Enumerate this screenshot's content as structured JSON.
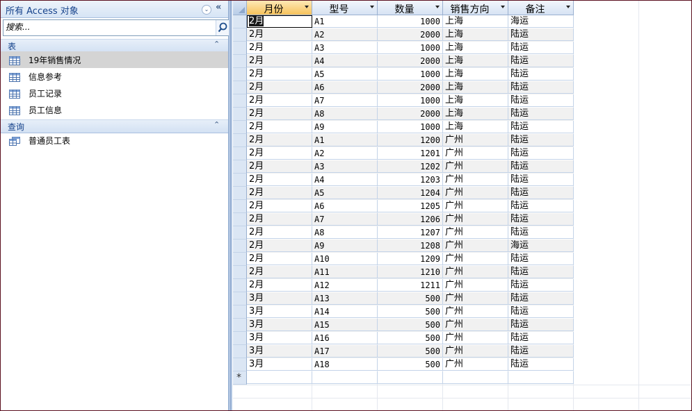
{
  "nav": {
    "title": "所有 Access 对象",
    "drop_glyph": "⌄",
    "collapse_glyph": "«",
    "search_placeholder": "搜索...",
    "groups": [
      {
        "label": "表",
        "toggle": "⌃",
        "items": [
          "19年销售情况",
          "信息参考",
          "员工记录",
          "员工信息"
        ]
      },
      {
        "label": "查询",
        "toggle": "⌃",
        "items": [
          "普通员工表"
        ]
      }
    ]
  },
  "datasheet": {
    "columns": [
      "月份",
      "型号",
      "数量",
      "销售方向",
      "备注"
    ],
    "rows": [
      [
        "2月",
        "A1",
        "1000",
        "上海",
        "海运"
      ],
      [
        "2月",
        "A2",
        "2000",
        "上海",
        "陆运"
      ],
      [
        "2月",
        "A3",
        "1000",
        "上海",
        "陆运"
      ],
      [
        "2月",
        "A4",
        "2000",
        "上海",
        "陆运"
      ],
      [
        "2月",
        "A5",
        "1000",
        "上海",
        "陆运"
      ],
      [
        "2月",
        "A6",
        "2000",
        "上海",
        "陆运"
      ],
      [
        "2月",
        "A7",
        "1000",
        "上海",
        "陆运"
      ],
      [
        "2月",
        "A8",
        "2000",
        "上海",
        "陆运"
      ],
      [
        "2月",
        "A9",
        "1000",
        "上海",
        "陆运"
      ],
      [
        "2月",
        "A1",
        "1200",
        "广州",
        "陆运"
      ],
      [
        "2月",
        "A2",
        "1201",
        "广州",
        "陆运"
      ],
      [
        "2月",
        "A3",
        "1202",
        "广州",
        "陆运"
      ],
      [
        "2月",
        "A4",
        "1203",
        "广州",
        "陆运"
      ],
      [
        "2月",
        "A5",
        "1204",
        "广州",
        "陆运"
      ],
      [
        "2月",
        "A6",
        "1205",
        "广州",
        "陆运"
      ],
      [
        "2月",
        "A7",
        "1206",
        "广州",
        "陆运"
      ],
      [
        "2月",
        "A8",
        "1207",
        "广州",
        "陆运"
      ],
      [
        "2月",
        "A9",
        "1208",
        "广州",
        "海运"
      ],
      [
        "2月",
        "A10",
        "1209",
        "广州",
        "陆运"
      ],
      [
        "2月",
        "A11",
        "1210",
        "广州",
        "陆运"
      ],
      [
        "2月",
        "A12",
        "1211",
        "广州",
        "陆运"
      ],
      [
        "3月",
        "A13",
        "500",
        "广州",
        "陆运"
      ],
      [
        "3月",
        "A14",
        "500",
        "广州",
        "陆运"
      ],
      [
        "3月",
        "A15",
        "500",
        "广州",
        "陆运"
      ],
      [
        "3月",
        "A16",
        "500",
        "广州",
        "陆运"
      ],
      [
        "3月",
        "A17",
        "500",
        "广州",
        "陆运"
      ],
      [
        "3月",
        "A18",
        "500",
        "广州",
        "陆运"
      ]
    ],
    "new_row_marker": "*"
  },
  "colors": {
    "nav_title_text": "#15428b",
    "active_header": "#f6c25c",
    "selected_item": "#d4d4d4",
    "window_border": "#5a0f1e"
  }
}
